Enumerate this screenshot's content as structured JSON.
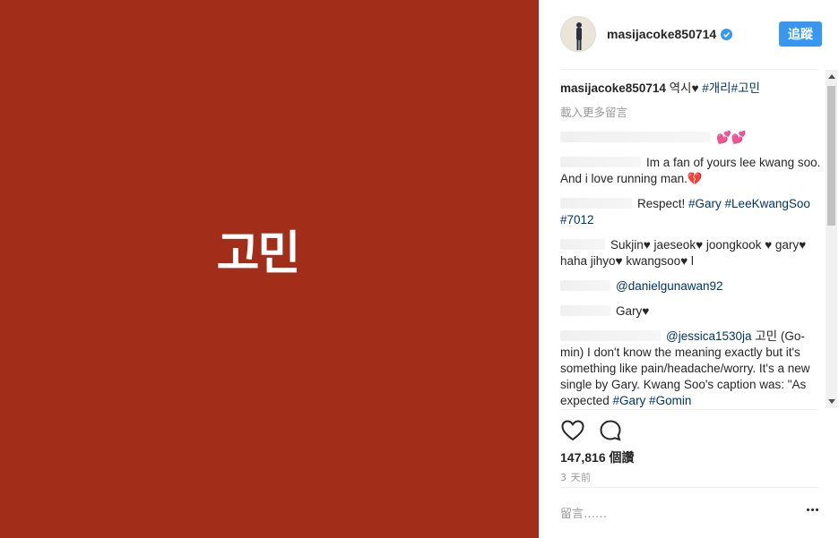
{
  "media": {
    "text": "고민",
    "background": "#a22e1a"
  },
  "header": {
    "username": "masijacoke850714",
    "verified_icon": "verified-badge-icon",
    "follow_label": "追蹤",
    "follow_color": "#3897f0"
  },
  "caption": {
    "username": "masijacoke850714",
    "text": "역시♥",
    "tags": "#개리#고민"
  },
  "load_more": "載入更多留言",
  "comments": [
    {
      "text": "💕💕",
      "tags": ""
    },
    {
      "text": "Im a fan of yours lee kwang soo. And i love running man.💔",
      "tags": ""
    },
    {
      "text": "Respect! ",
      "tags": "#Gary #LeeKwangSoo #7012"
    },
    {
      "text": "Sukjin♥ jaeseok♥ joongkook ♥ gary♥ haha jihyo♥ kwangsoo♥ l",
      "tags": ""
    },
    {
      "text": "",
      "tags": "@danielgunawan92"
    },
    {
      "text": "Gary♥",
      "tags": ""
    },
    {
      "mention": "@jessica1530ja",
      "text": " 고민 (Go-min) I don't know the meaning exactly but it's something like pain/headache/worry. It's a new single by Gary. Kwang Soo's caption was: \"As expected ",
      "tags": "#Gary #Gomin"
    }
  ],
  "actions": {
    "like_icon": "heart-icon",
    "comment_icon": "comment-icon"
  },
  "likes": {
    "count": "147,816",
    "unit": "個讚"
  },
  "time": "3 天前",
  "comment_box": {
    "placeholder": "留言……",
    "more_icon": "more-options-icon"
  }
}
